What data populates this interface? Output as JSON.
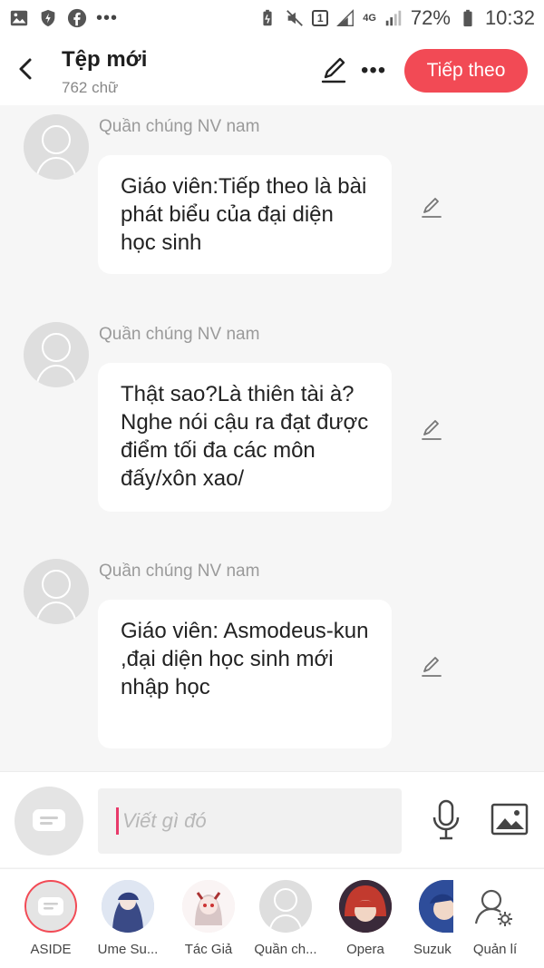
{
  "status_bar": {
    "battery": "72%",
    "time": "10:32",
    "sim_badge": "1",
    "network": "4G"
  },
  "header": {
    "title": "Tệp mới",
    "subtitle": "762 chữ",
    "next_label": "Tiếp theo"
  },
  "messages": [
    {
      "author": "Quần chúng NV nam",
      "text": "Giáo viên:Tiếp theo là bài phát biểu của đại diện học sinh"
    },
    {
      "author": "Quần chúng NV nam",
      "text": "Thật sao?Là thiên tài à?Nghe nói cậu ra đạt được điểm tối đa các môn đấy/xôn xao/"
    },
    {
      "author": "Quần chúng NV nam",
      "text": "Giáo viên: Asmodeus-kun ,đại diện học sinh mới nhập học"
    }
  ],
  "composer": {
    "placeholder": "Viết gì đó"
  },
  "characters": [
    {
      "name": "ASIDE"
    },
    {
      "name": "Ume Su..."
    },
    {
      "name": "Tác Giả"
    },
    {
      "name": "Quần ch..."
    },
    {
      "name": "Opera"
    },
    {
      "name": "Suzuk"
    },
    {
      "name": "Quản lí"
    }
  ],
  "colors": {
    "accent": "#f24a55",
    "caret": "#e83a6a",
    "background": "#f6f6f6"
  }
}
